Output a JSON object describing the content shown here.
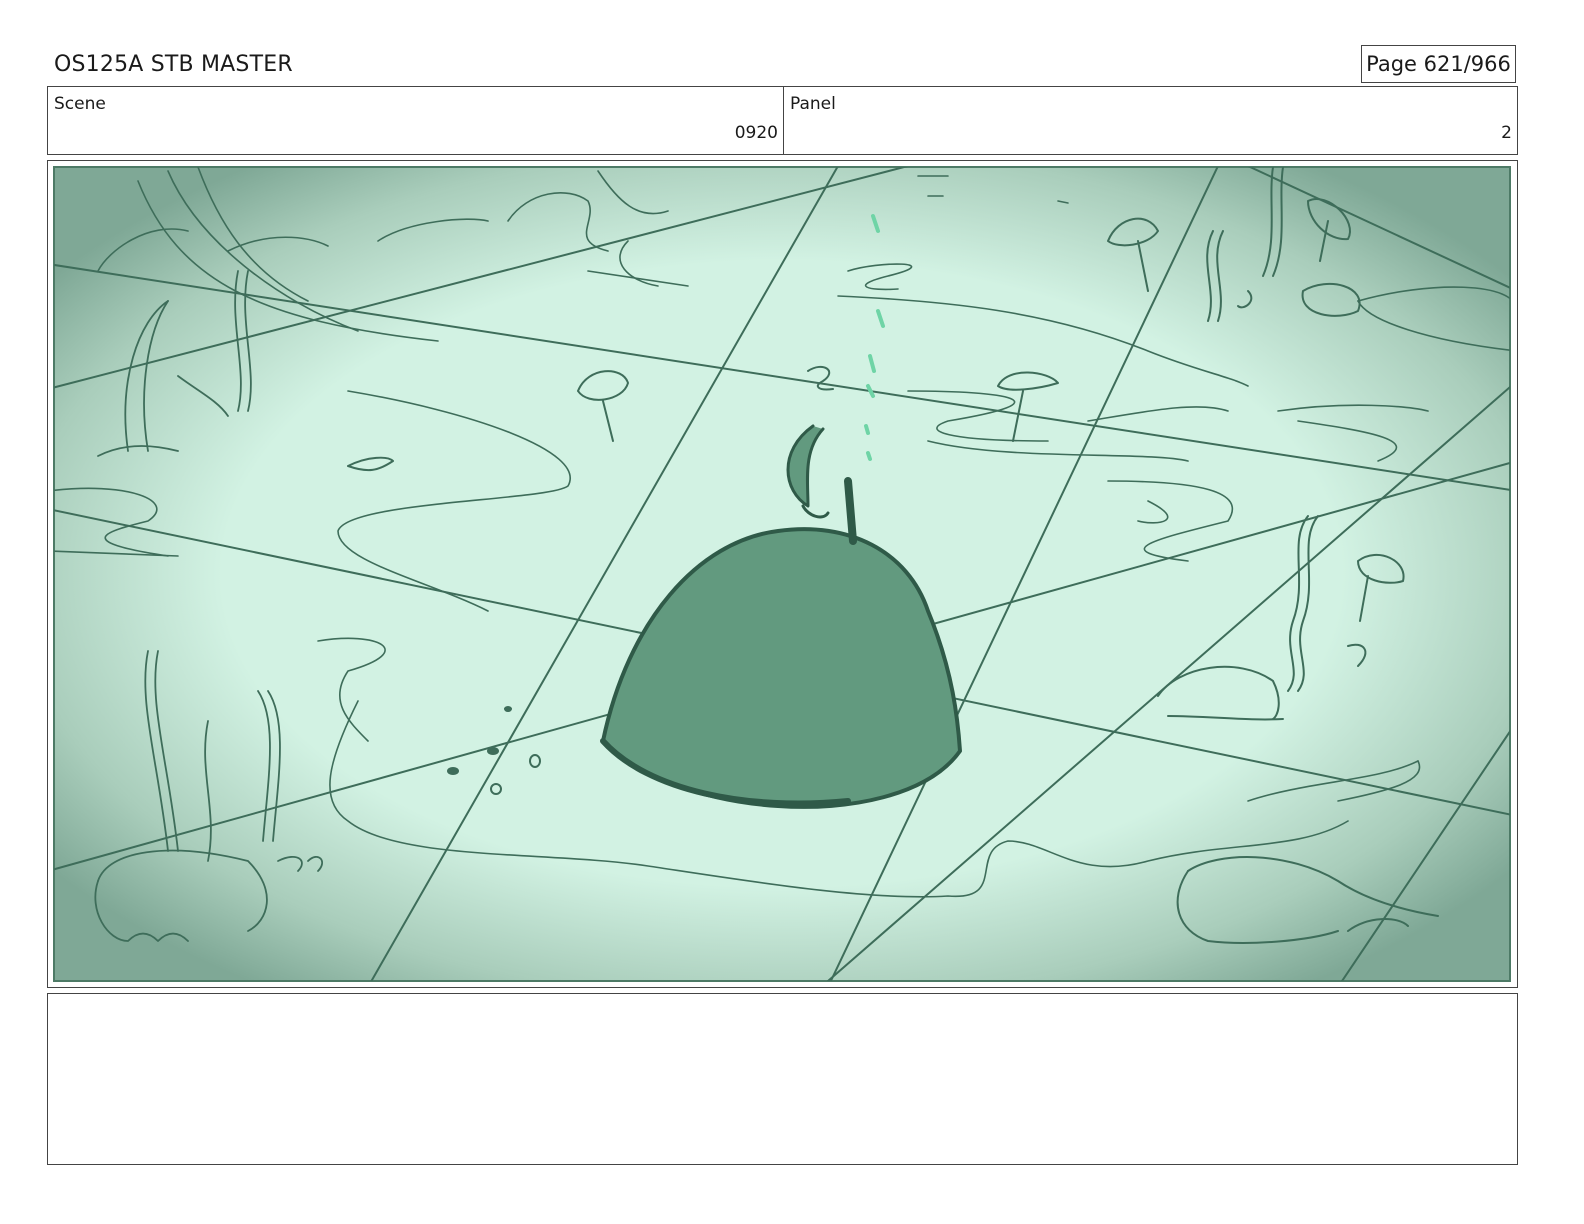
{
  "header": {
    "title": "OS125A STB MASTER",
    "page": "Page 621/966"
  },
  "info": {
    "scene_label": "Scene",
    "scene_value": "0920",
    "panel_label": "Panel",
    "panel_value": "2"
  },
  "artwork": {
    "palette": {
      "floor": "#d2f2e3",
      "vignette": "#7fa896",
      "line": "#3e6d5a",
      "mound": "#629a7f",
      "bubbles": "#6fd4a6"
    }
  },
  "notes": ""
}
